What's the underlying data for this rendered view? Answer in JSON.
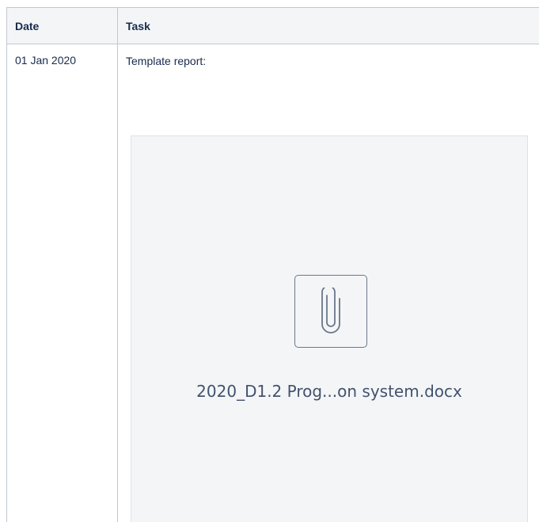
{
  "table": {
    "headers": {
      "date": "Date",
      "task": "Task"
    },
    "rows": [
      {
        "date": "01 Jan 2020",
        "task": "Template report:",
        "attachment": {
          "file_name": "2020_D1.2 Prog...on system.docx",
          "icon": "paperclip-icon"
        }
      }
    ]
  }
}
